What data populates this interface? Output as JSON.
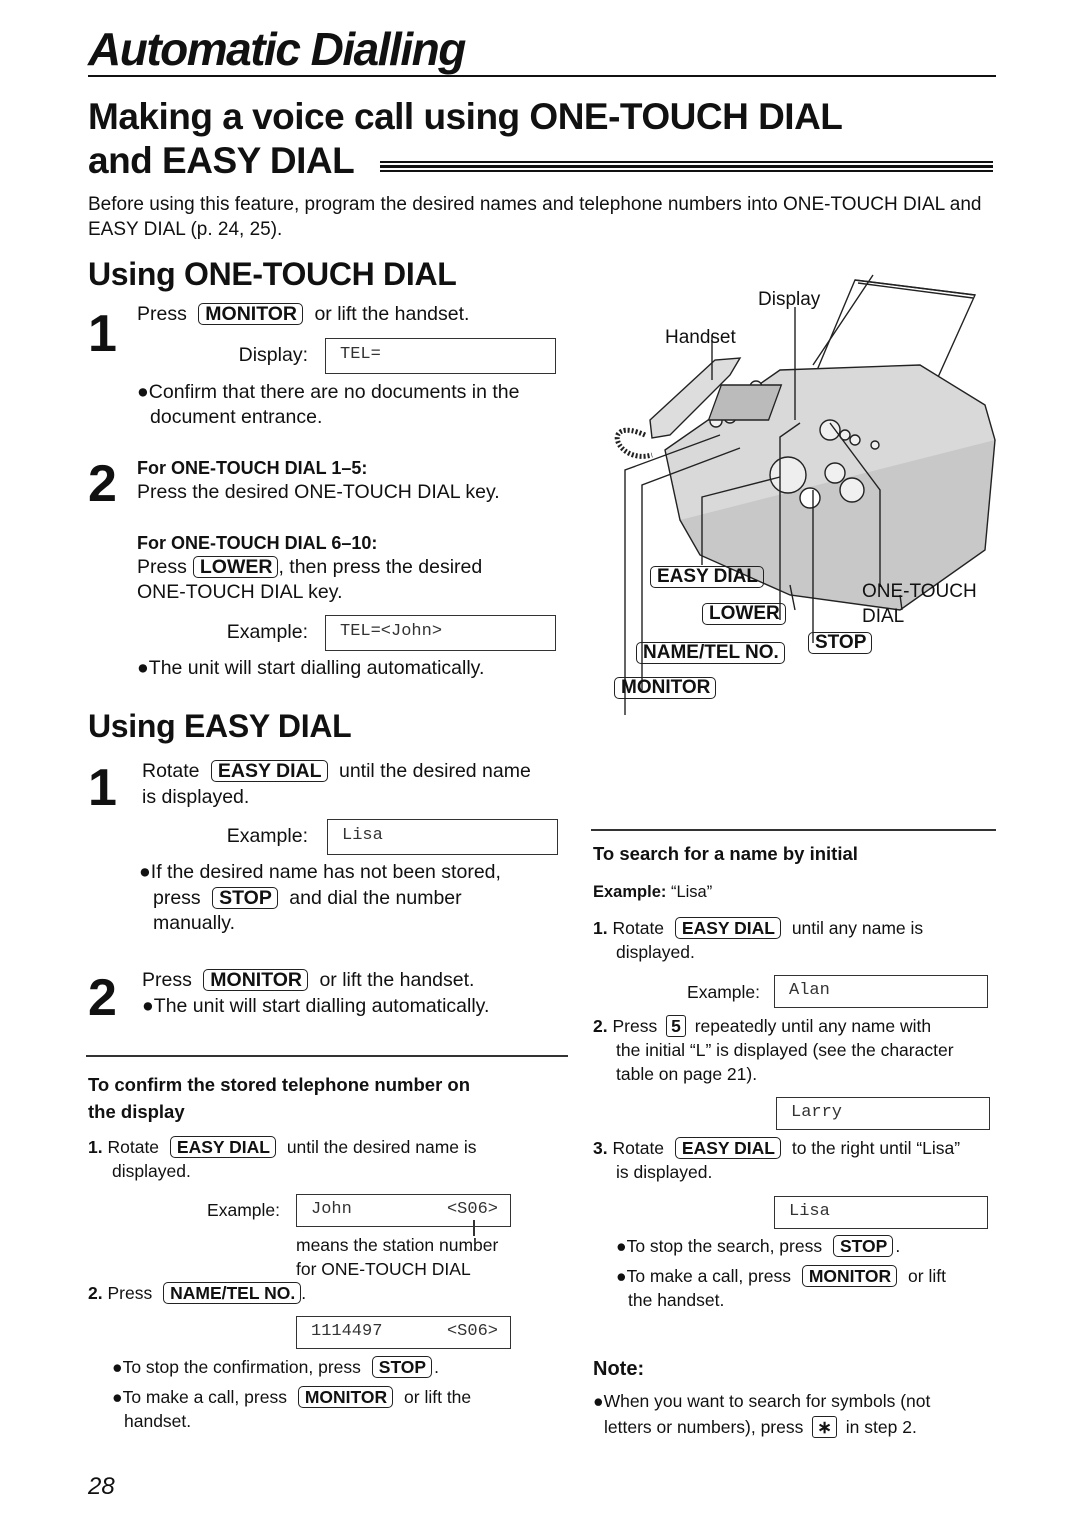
{
  "page": {
    "title": "Automatic Dialling",
    "section_title_line1": "Making a voice call using ONE-TOUCH DIAL",
    "section_title_line2": "and EASY DIAL",
    "intro": "Before using this feature, program the desired names and telephone numbers into ONE-TOUCH DIAL and EASY DIAL (p. 24, 25).",
    "page_number": "28"
  },
  "keys": {
    "monitor": "MONITOR",
    "lower": "LOWER",
    "easy_dial": "EASY DIAL",
    "stop": "STOP",
    "name_tel_no": "NAME/TEL NO.",
    "five": "5",
    "star": "∗"
  },
  "one_touch": {
    "heading": "Using ONE-TOUCH DIAL",
    "step1": {
      "num": "1",
      "pre": "Press",
      "post": "or lift the handset.",
      "display_label": "Display:",
      "display_value": "TEL=",
      "bullet": "●Confirm that there are no documents in the",
      "bullet_cont": "document entrance."
    },
    "step2": {
      "num": "2",
      "sub1_heading": "For ONE-TOUCH DIAL 1–5:",
      "sub1_text": "Press the desired ONE-TOUCH DIAL key.",
      "sub2_heading": "For ONE-TOUCH DIAL 6–10:",
      "sub2_pre": "Press",
      "sub2_post": ", then press the desired",
      "sub2_cont": "ONE-TOUCH DIAL key.",
      "example_label": "Example:",
      "example_value": "TEL=<John>",
      "bullet": "●The unit will start dialling automatically."
    }
  },
  "easy_dial": {
    "heading": "Using EASY DIAL",
    "step1": {
      "num": "1",
      "pre": "Rotate",
      "post": "until the desired name",
      "cont": "is displayed.",
      "example_label": "Example:",
      "example_value": "Lisa",
      "bullet": "●If the desired name has not been stored,",
      "bullet_pre": "press",
      "bullet_post": "and dial the number",
      "bullet_cont": "manually."
    },
    "step2": {
      "num": "2",
      "pre": "Press",
      "post": "or lift the handset.",
      "bullet": "●The unit will start dialling automatically."
    }
  },
  "confirm": {
    "heading_line1": "To confirm the stored telephone number on",
    "heading_line2": "the display",
    "step1_num": "1.",
    "step1_pre": "Rotate",
    "step1_post": "until the desired name is",
    "step1_cont": "displayed.",
    "example_label": "Example:",
    "lcd1_name": "John",
    "lcd1_station": "<S06>",
    "station_note_line1": "means the station number",
    "station_note_line2": "for ONE-TOUCH DIAL",
    "step2_num": "2.",
    "step2_pre": "Press",
    "step2_post": ".",
    "lcd2_number": "1114497",
    "lcd2_station": "<S06>",
    "bullet1_pre": "●To stop the confirmation, press",
    "bullet1_post": ".",
    "bullet2_pre": "●To make a call, press",
    "bullet2_post": "or lift the",
    "bullet2_cont": "handset."
  },
  "search": {
    "heading": "To search for a name by initial",
    "example_bold": "Example:",
    "example_value": "“Lisa”",
    "step1_num": "1.",
    "step1_pre": "Rotate",
    "step1_post": "until any name is",
    "step1_cont": "displayed.",
    "example_label": "Example:",
    "lcd1": "Alan",
    "step2_num": "2.",
    "step2_pre": "Press",
    "step2_post": "repeatedly until any name with",
    "step2_cont1": "the initial “L” is displayed (see the character",
    "step2_cont2": "table on page 21).",
    "lcd2": "Larry",
    "step3_num": "3.",
    "step3_pre": "Rotate",
    "step3_post": "to the right until “Lisa”",
    "step3_cont": "is displayed.",
    "lcd3": "Lisa",
    "bullet1_pre": "●To stop the search, press",
    "bullet1_post": ".",
    "bullet2_pre": "●To make a call, press",
    "bullet2_post": "or lift",
    "bullet2_cont": "the handset."
  },
  "note": {
    "heading": "Note:",
    "line1": "●When you want to search for symbols (not",
    "line2_pre": "letters or numbers), press",
    "line2_post": "in step 2."
  },
  "illustration": {
    "label_display": "Display",
    "label_handset": "Handset",
    "label_one_touch_1": "ONE-TOUCH",
    "label_one_touch_2": "DIAL",
    "key_easy_dial": "EASY DIAL",
    "key_lower": "LOWER",
    "key_name_tel": "NAME/TEL NO.",
    "key_stop": "STOP",
    "key_monitor": "MONITOR"
  }
}
